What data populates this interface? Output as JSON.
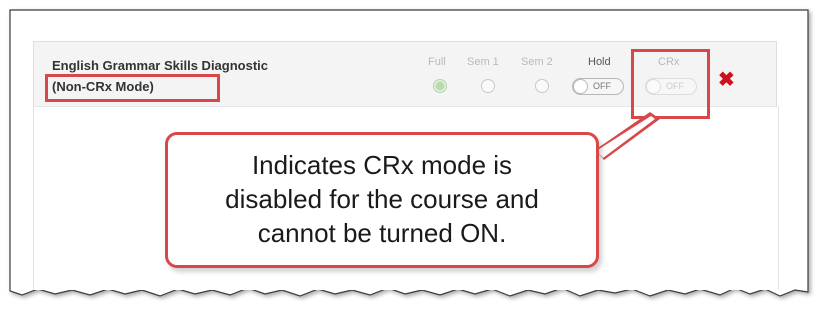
{
  "course": {
    "title": "English Grammar Skills Diagnostic",
    "mode": "(Non-CRx Mode)"
  },
  "columns": {
    "full": "Full",
    "sem1": "Sem 1",
    "sem2": "Sem 2",
    "hold": "Hold",
    "crx": "CRx"
  },
  "controls": {
    "full_selected": true,
    "hold_toggle_text": "OFF",
    "crx_toggle_text": "OFF",
    "crx_disabled": true
  },
  "remove_glyph": "✖",
  "callout": {
    "line1": "Indicates CRx mode is",
    "line2": "disabled for the course and",
    "line3": "cannot be turned ON."
  },
  "colors": {
    "highlight": "#d84848",
    "remove": "#d0101c",
    "selected_radio": "#b8dcae"
  }
}
